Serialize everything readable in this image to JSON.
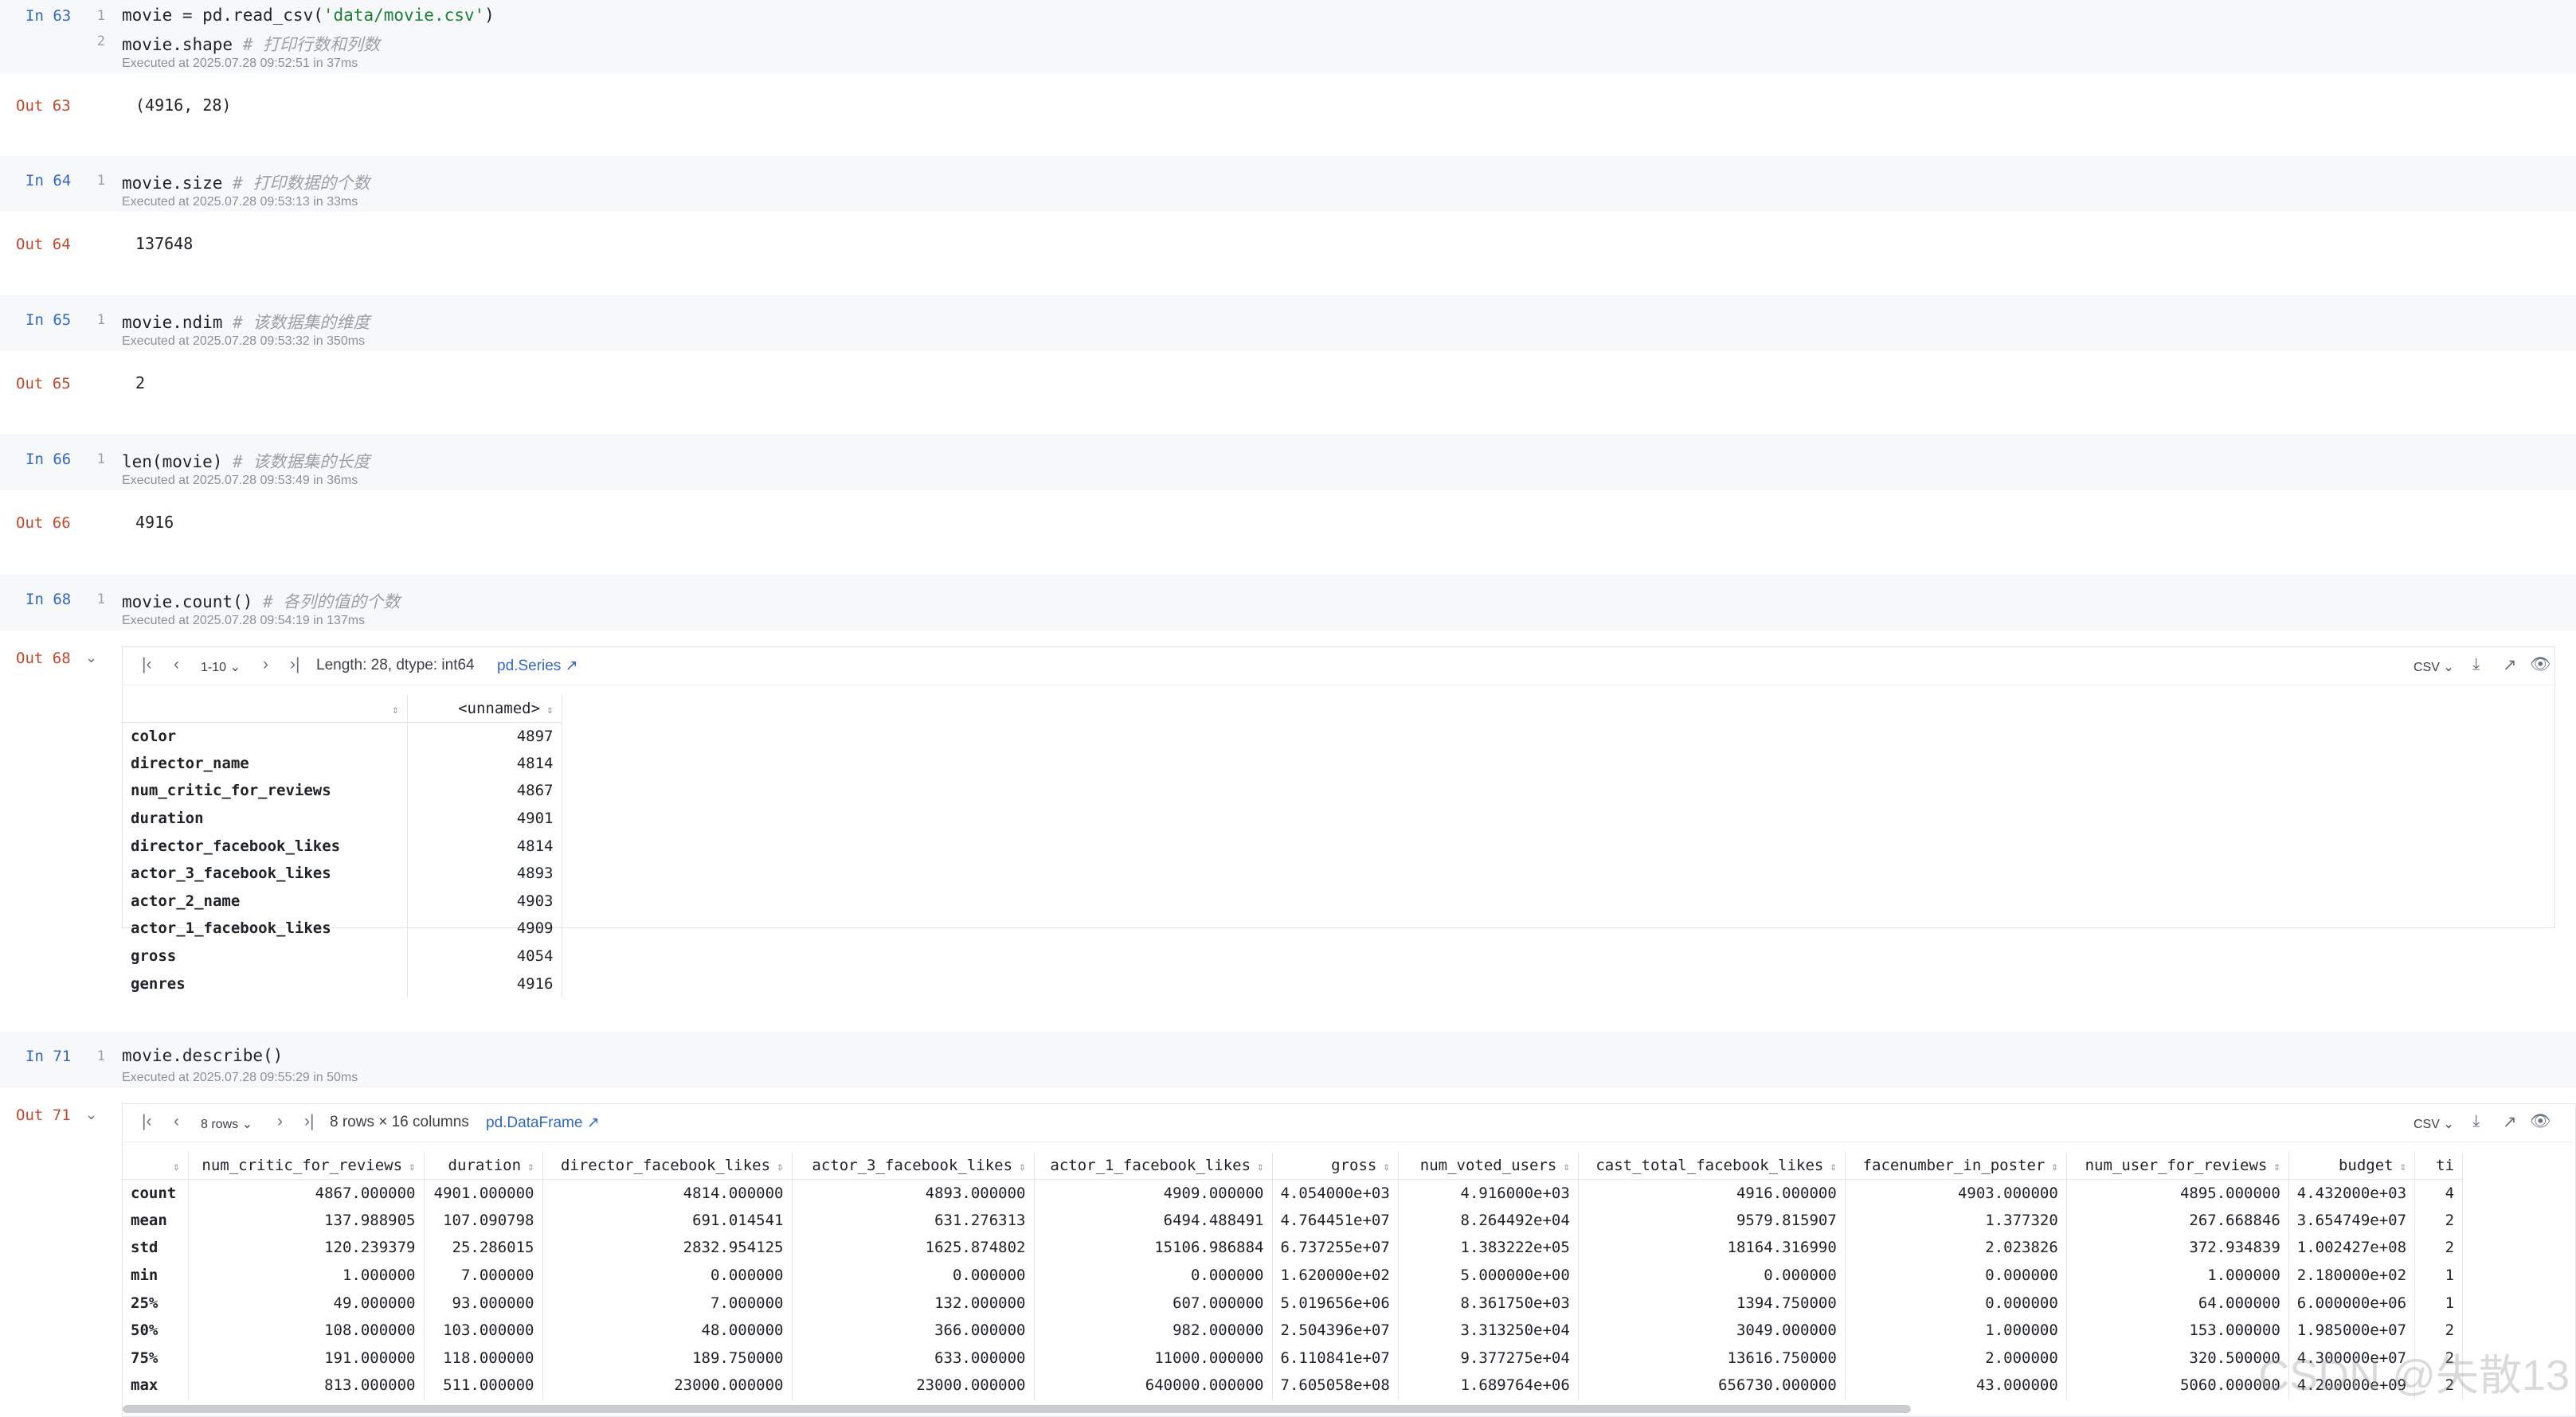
{
  "cells": [
    {
      "in_prompt": "In 63",
      "lines": [
        {
          "no": "1",
          "code": "movie = pd.read_csv(",
          "str": "'data/movie.csv'",
          "after": ")",
          "comment": ""
        },
        {
          "no": "2",
          "code": "movie.shape ",
          "str": "",
          "after": "",
          "comment": "# 打印行数和列数"
        }
      ],
      "executed": "Executed at 2025.07.28 09:52:51 in 37ms",
      "out_prompt": "Out 63",
      "output": "(4916, 28)"
    },
    {
      "in_prompt": "In 64",
      "lines": [
        {
          "no": "1",
          "code": "movie.size ",
          "str": "",
          "after": "",
          "comment": "# 打印数据的个数"
        }
      ],
      "executed": "Executed at 2025.07.28 09:53:13 in 33ms",
      "out_prompt": "Out 64",
      "output": "137648"
    },
    {
      "in_prompt": "In 65",
      "lines": [
        {
          "no": "1",
          "code": "movie.ndim ",
          "str": "",
          "after": "",
          "comment": "# 该数据集的维度"
        }
      ],
      "executed": "Executed at 2025.07.28 09:53:32 in 350ms",
      "out_prompt": "Out 65",
      "output": "2"
    },
    {
      "in_prompt": "In 66",
      "lines": [
        {
          "no": "1",
          "code": "len(movie) ",
          "str": "",
          "after": "",
          "comment": "# 该数据集的长度"
        }
      ],
      "executed": "Executed at 2025.07.28 09:53:49 in 36ms",
      "out_prompt": "Out 66",
      "output": "4916"
    },
    {
      "in_prompt": "In 68",
      "lines": [
        {
          "no": "1",
          "code": "movie.count() ",
          "str": "",
          "after": "",
          "comment": "# 各列的值的个数"
        }
      ],
      "executed": "Executed at 2025.07.28 09:54:19 in 137ms",
      "out_prompt": "Out 68"
    },
    {
      "in_prompt": "In 71",
      "lines": [
        {
          "no": "1",
          "code": "movie.describe()",
          "str": "",
          "after": "",
          "comment": ""
        }
      ],
      "executed": "Executed at 2025.07.28 09:55:29 in 50ms",
      "out_prompt": "Out 71"
    }
  ],
  "series_panel": {
    "range": "1-10",
    "info": "Length: 28, dtype: int64",
    "type_link": "pd.Series",
    "format": "CSV",
    "column": "<unnamed>",
    "rows": [
      {
        "index": "color",
        "value": "4897"
      },
      {
        "index": "director_name",
        "value": "4814"
      },
      {
        "index": "num_critic_for_reviews",
        "value": "4867"
      },
      {
        "index": "duration",
        "value": "4901"
      },
      {
        "index": "director_facebook_likes",
        "value": "4814"
      },
      {
        "index": "actor_3_facebook_likes",
        "value": "4893"
      },
      {
        "index": "actor_2_name",
        "value": "4903"
      },
      {
        "index": "actor_1_facebook_likes",
        "value": "4909"
      },
      {
        "index": "gross",
        "value": "4054"
      },
      {
        "index": "genres",
        "value": "4916"
      }
    ]
  },
  "frame_panel": {
    "rows_select": "8 rows",
    "info": "8 rows × 16 columns",
    "type_link": "pd.DataFrame",
    "format": "CSV",
    "columns": [
      "num_critic_for_reviews",
      "duration",
      "director_facebook_likes",
      "actor_3_facebook_likes",
      "actor_1_facebook_likes",
      "gross",
      "num_voted_users",
      "cast_total_facebook_likes",
      "facenumber_in_poster",
      "num_user_for_reviews",
      "budget",
      "ti"
    ],
    "rows": [
      {
        "index": "count",
        "values": [
          "4867.000000",
          "4901.000000",
          "4814.000000",
          "4893.000000",
          "4909.000000",
          "4.054000e+03",
          "4.916000e+03",
          "4916.000000",
          "4903.000000",
          "4895.000000",
          "4.432000e+03",
          "4"
        ]
      },
      {
        "index": "mean",
        "values": [
          "137.988905",
          "107.090798",
          "691.014541",
          "631.276313",
          "6494.488491",
          "4.764451e+07",
          "8.264492e+04",
          "9579.815907",
          "1.377320",
          "267.668846",
          "3.654749e+07",
          "2"
        ]
      },
      {
        "index": "std",
        "values": [
          "120.239379",
          "25.286015",
          "2832.954125",
          "1625.874802",
          "15106.986884",
          "6.737255e+07",
          "1.383222e+05",
          "18164.316990",
          "2.023826",
          "372.934839",
          "1.002427e+08",
          "2"
        ]
      },
      {
        "index": "min",
        "values": [
          "1.000000",
          "7.000000",
          "0.000000",
          "0.000000",
          "0.000000",
          "1.620000e+02",
          "5.000000e+00",
          "0.000000",
          "0.000000",
          "1.000000",
          "2.180000e+02",
          "1"
        ]
      },
      {
        "index": "25%",
        "values": [
          "49.000000",
          "93.000000",
          "7.000000",
          "132.000000",
          "607.000000",
          "5.019656e+06",
          "8.361750e+03",
          "1394.750000",
          "0.000000",
          "64.000000",
          "6.000000e+06",
          "1"
        ]
      },
      {
        "index": "50%",
        "values": [
          "108.000000",
          "103.000000",
          "48.000000",
          "366.000000",
          "982.000000",
          "2.504396e+07",
          "3.313250e+04",
          "3049.000000",
          "1.000000",
          "153.000000",
          "1.985000e+07",
          "2"
        ]
      },
      {
        "index": "75%",
        "values": [
          "191.000000",
          "118.000000",
          "189.750000",
          "633.000000",
          "11000.000000",
          "6.110841e+07",
          "9.377275e+04",
          "13616.750000",
          "2.000000",
          "320.500000",
          "4.300000e+07",
          "2"
        ]
      },
      {
        "index": "max",
        "values": [
          "813.000000",
          "511.000000",
          "23000.000000",
          "23000.000000",
          "640000.000000",
          "7.605058e+08",
          "1.689764e+06",
          "656730.000000",
          "43.000000",
          "5060.000000",
          "4.200000e+09",
          "2"
        ]
      }
    ]
  },
  "icons": {
    "first": "first-page-icon",
    "prev": "prev-page-icon",
    "next": "next-page-icon",
    "last": "last-page-icon",
    "download": "download-icon",
    "open": "open-external-icon",
    "view": "eye-icon"
  },
  "watermark": "CSDN @失散13"
}
